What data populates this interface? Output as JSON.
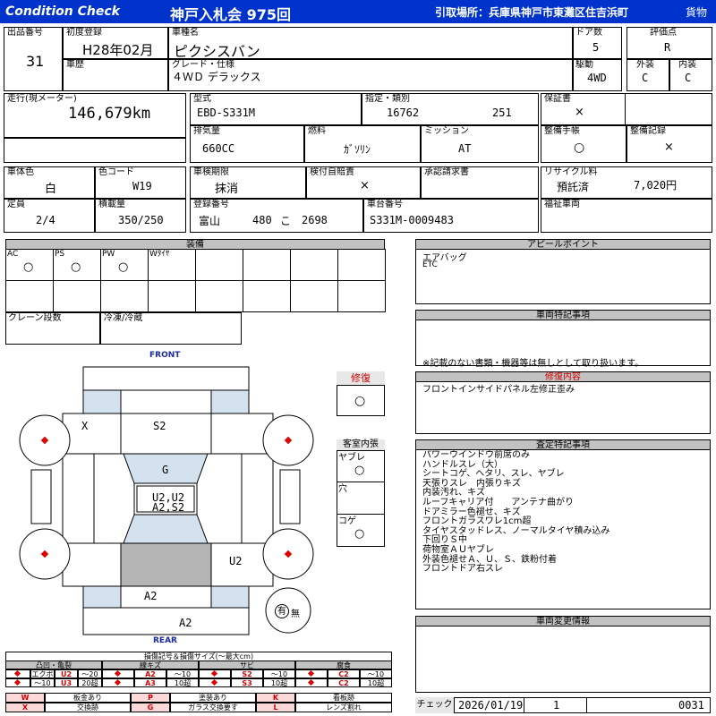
{
  "header": {
    "title": "Condition Check",
    "auction": "神戸入札会 975回",
    "pickup": "引取場所：兵庫県神戸市東灘区住吉浜町",
    "category": "貨物"
  },
  "info": {
    "lot_no_label": "出品番号",
    "lot_no": "31",
    "first_reg_label": "初度登録",
    "first_reg": "H28年02月",
    "car_name_label": "車種名",
    "car_name": "ピクシスバン",
    "doors_label": "ドア数",
    "doors": "5",
    "score_label": "評価点",
    "score": "R",
    "history_label": "車歴",
    "grade_label": "グレード・仕様",
    "grade": "４ＷＤ デラックス",
    "drive_label": "駆動",
    "drive": "4WD",
    "ext_label": "外装",
    "ext": "C",
    "int_label": "内装",
    "int": "C",
    "mileage_label": "走行(現メーター)",
    "mileage": "146,679km",
    "model_label": "型式",
    "model": "EBD-S331M",
    "spec_label": "指定・類別",
    "spec_no": "16762",
    "class_no": "251",
    "warranty_label": "保証書",
    "warranty": "×",
    "displacement_label": "排気量",
    "displacement": "660CC",
    "fuel_label": "燃料",
    "fuel": "ｶﾞｿﾘﾝ",
    "mission_label": "ミッション",
    "mission": "AT",
    "manual_label": "整備手帳",
    "manual": "○",
    "record_label": "整備記録",
    "record": "×",
    "body_color_label": "車体色",
    "body_color": "白",
    "color_code_label": "色コード",
    "color_code": "W19",
    "inspection_label": "車検期限",
    "inspection": "抹消",
    "liability_label": "検付自賠責",
    "liability": "×",
    "approval_label": "承認請求書",
    "recycle_label": "リサイクル料",
    "recycle_status": "預託済",
    "recycle_fee": "7,020円",
    "capacity_label": "定員",
    "capacity": "2/4",
    "load_label": "積載量",
    "load": "350/250",
    "reg_no_label": "登録番号",
    "reg_area": "富山",
    "reg_class": "480",
    "reg_kana": "こ",
    "reg_num": "2698",
    "chassis_label": "車台番号",
    "chassis": "S331M-0009483",
    "welfare_label": "福祉車両"
  },
  "equipment": {
    "title": "装備",
    "items": [
      {
        "label": "AC",
        "mark": "○"
      },
      {
        "label": "PS",
        "mark": "○"
      },
      {
        "label": "PW",
        "mark": "○"
      },
      {
        "label": "Wﾀｲﾔ",
        "mark": ""
      }
    ],
    "crane_label": "クレーン段数",
    "freezer_label": "冷凍/冷蔵"
  },
  "diagram": {
    "front": "FRONT",
    "rear": "REAR",
    "marks": {
      "x": "X",
      "s2_top": "S2",
      "g": "G",
      "center1": "U2,U2",
      "center2": "A2,S2",
      "u2_side": "U2",
      "a2_lower": "A2",
      "a2_rear": "A2"
    },
    "spare_yes": "有",
    "spare_no": "無"
  },
  "repair": {
    "label": "修復",
    "mark": "○"
  },
  "interior": {
    "label": "客室内張",
    "tear_label": "ヤブレ",
    "tear": "○",
    "hole_label": "穴",
    "burn_label": "コゲ",
    "burn": "○"
  },
  "appeal": {
    "title": "アピールポイント",
    "lines": [
      "エアバッグ",
      "ETC"
    ]
  },
  "special": {
    "title": "車両特記事項",
    "note": "※記載のない書類・機器等は無しとして取り扱います。"
  },
  "repair_detail": {
    "title": "修復内容",
    "lines": [
      "フロントインサイドパネル左修正歪み"
    ]
  },
  "inspection_notes": {
    "title": "査定特記事項",
    "lines": [
      "パワーウインドウ前席のみ",
      "ハンドルスレ（大）",
      "シートコゲ、ヘタリ、スレ、ヤブレ",
      "天張りスレ　内張りキズ",
      "内装汚れ、キズ",
      "ルーフキャリア付　　アンテナ曲がり",
      "ドアミラー色褪せ、キズ",
      "フロントガラスワレ1cm超",
      "タイヤスタッドレス、ノーマルタイヤ積み込み",
      "下回りＳ中",
      "荷物室ＡＵヤブレ",
      "外装色褪せＡ、Ｕ、Ｓ、鉄粉付着",
      "フロントドア右スレ"
    ]
  },
  "change_info": {
    "title": "車両変更情報"
  },
  "legend": {
    "title": "損傷記号＆損傷サイズ(～最大cm)",
    "groups": [
      {
        "name": "凸凹・亀裂",
        "c1": "エクボ",
        "c2": "U2",
        "c3": "～20",
        "d1": "～10",
        "d2": "U3",
        "d3": "20超"
      },
      {
        "name": "線キズ",
        "c1": "A2",
        "c2": "～10",
        "d1": "A3",
        "d2": "10超"
      },
      {
        "name": "サビ",
        "c1": "S2",
        "c2": "～10",
        "d1": "S3",
        "d2": "10超"
      },
      {
        "name": "腐食",
        "c1": "C2",
        "c2": "～10",
        "d1": "C2",
        "d2": "10超"
      }
    ],
    "codes": [
      {
        "k1": "W",
        "v1": "板金あり",
        "k2": "P",
        "v2": "塗装あり",
        "k3": "K",
        "v3": "看板跡"
      },
      {
        "k1": "X",
        "v1": "交換跡",
        "k2": "G",
        "v2": "ガラス交換要す",
        "k3": "L",
        "v3": "レンズ割れ"
      }
    ]
  },
  "check": {
    "label": "チェック",
    "date": "2026/01/19",
    "num1": "1",
    "num2": "0031"
  },
  "colors": {
    "header_bg": "#0033cc",
    "accent_red": "#e00000",
    "panel_blue": "#d4e2f0",
    "panel_gray": "#b4b4b4"
  }
}
